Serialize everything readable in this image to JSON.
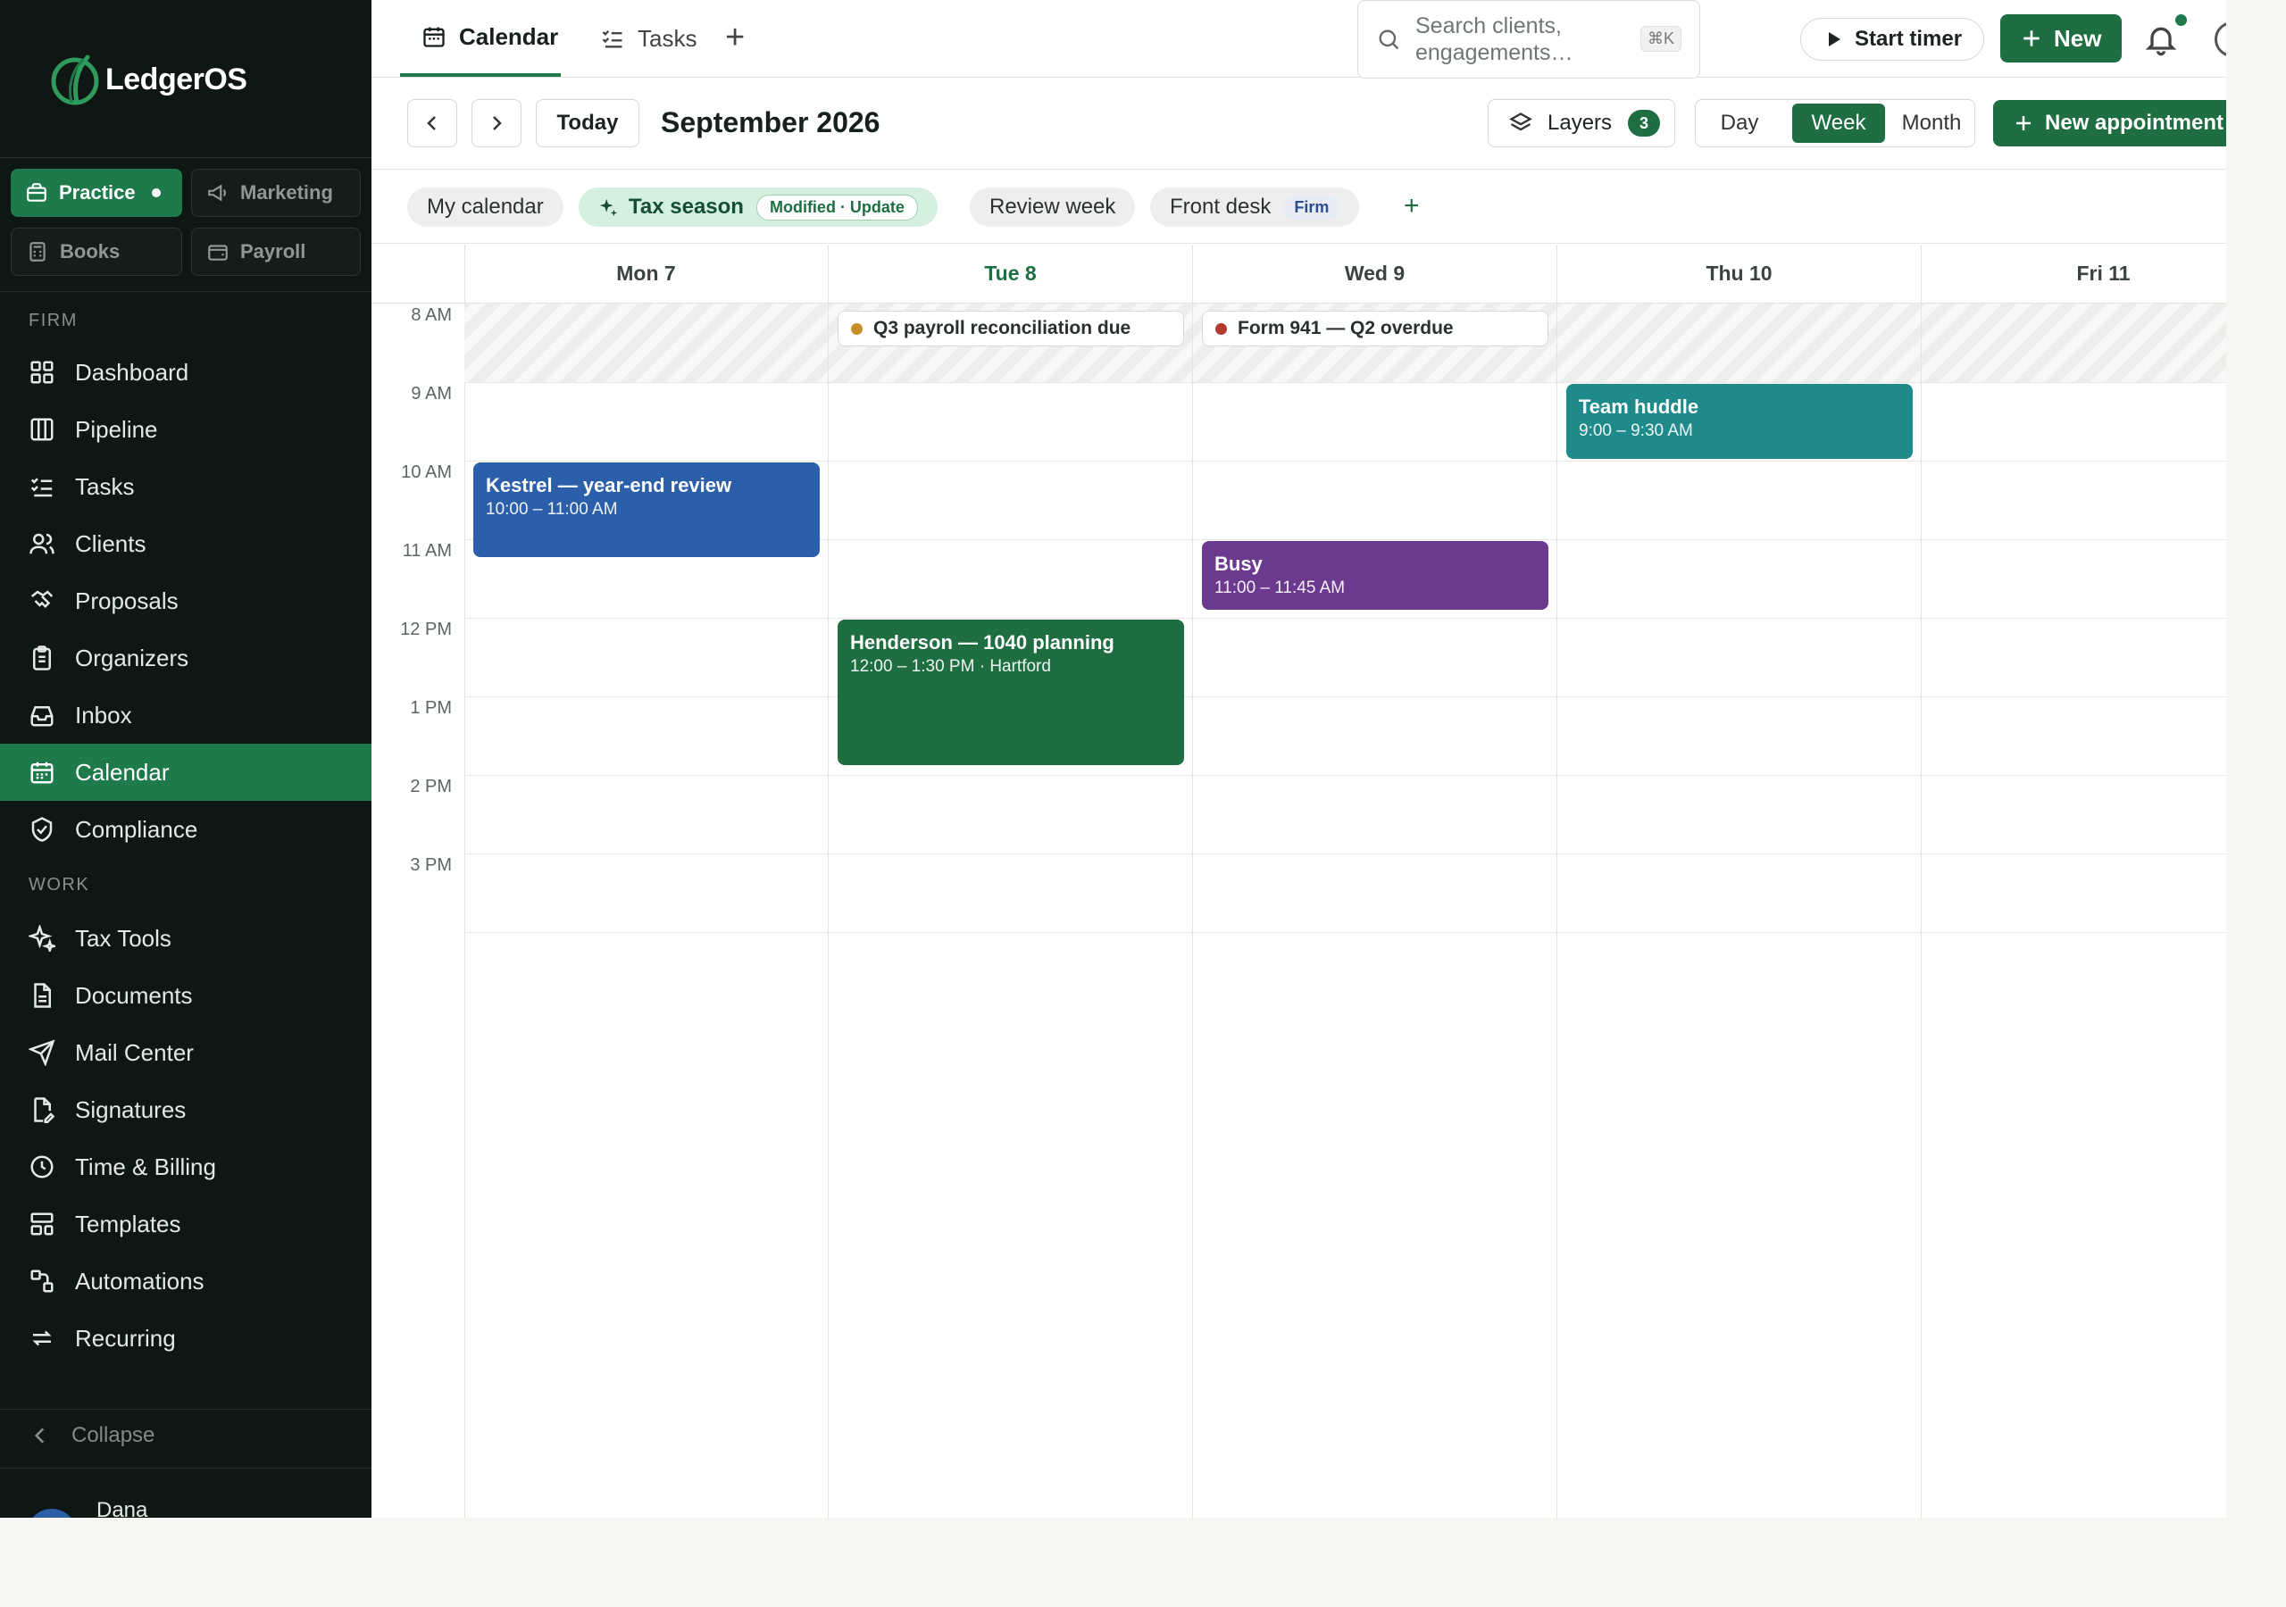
{
  "brand": {
    "name": "LedgerOS",
    "accent": "#1e7a4a"
  },
  "products": [
    {
      "label": "Practice",
      "icon": "briefcase-icon",
      "active": true
    },
    {
      "label": "Marketing",
      "icon": "megaphone-icon",
      "active": false
    },
    {
      "label": "Books",
      "icon": "calculator-icon",
      "active": false
    },
    {
      "label": "Payroll",
      "icon": "wallet-icon",
      "active": false
    }
  ],
  "sidebar": {
    "firm_label": "FIRM",
    "work_label": "WORK",
    "firm_items": [
      {
        "label": "Dashboard",
        "icon": "grid-icon"
      },
      {
        "label": "Pipeline",
        "icon": "columns-icon"
      },
      {
        "label": "Tasks",
        "icon": "checklist-icon"
      },
      {
        "label": "Clients",
        "icon": "users-icon"
      },
      {
        "label": "Proposals",
        "icon": "handshake-icon"
      },
      {
        "label": "Organizers",
        "icon": "clipboard-icon"
      },
      {
        "label": "Inbox",
        "icon": "inbox-icon"
      },
      {
        "label": "Calendar",
        "icon": "calendar-icon",
        "active": true
      },
      {
        "label": "Compliance",
        "icon": "shield-check-icon"
      }
    ],
    "work_items": [
      {
        "label": "Tax Tools",
        "icon": "sparkle-icon"
      },
      {
        "label": "Documents",
        "icon": "document-icon"
      },
      {
        "label": "Mail Center",
        "icon": "send-icon"
      },
      {
        "label": "Signatures",
        "icon": "signature-icon"
      },
      {
        "label": "Time & Billing",
        "icon": "clock-icon"
      },
      {
        "label": "Templates",
        "icon": "layout-icon"
      },
      {
        "label": "Automations",
        "icon": "workflow-icon"
      },
      {
        "label": "Recurring",
        "icon": "repeat-icon"
      }
    ],
    "collapse_label": "Collapse",
    "user_name": "Dana"
  },
  "topbar": {
    "tabs": [
      {
        "label": "Calendar",
        "icon": "calendar-icon",
        "active": true
      },
      {
        "label": "Tasks",
        "icon": "checklist-icon",
        "active": false
      }
    ],
    "search_placeholder": "Search clients, engagements…",
    "search_shortcut": "⌘K",
    "start_timer_label": "Start timer",
    "new_label": "New"
  },
  "toolbar": {
    "today_label": "Today",
    "month_title": "September 2026",
    "layers_label": "Layers",
    "layers_count": "3",
    "views": [
      {
        "label": "Day",
        "active": false
      },
      {
        "label": "Week",
        "active": true
      },
      {
        "label": "Month",
        "active": false
      }
    ],
    "new_appointment_label": "New appointment"
  },
  "chips": [
    {
      "label": "My calendar"
    },
    {
      "label": "Tax season",
      "active": true,
      "badge": "Modified · Update"
    },
    {
      "label": "Review week"
    },
    {
      "label": "Front desk",
      "tag": "Firm"
    }
  ],
  "calendar": {
    "days": [
      {
        "label": "Mon 7",
        "today": false
      },
      {
        "label": "Tue 8",
        "today": true
      },
      {
        "label": "Wed 9",
        "today": false
      },
      {
        "label": "Thu 10",
        "today": false
      },
      {
        "label": "Fri 11",
        "today": false
      }
    ],
    "hours": [
      "8 AM",
      "9 AM",
      "10 AM",
      "11 AM",
      "12 PM",
      "1 PM",
      "2 PM",
      "3 PM"
    ],
    "deadlines": [
      {
        "title": "Q3 payroll reconciliation due",
        "day": 1,
        "color": "#c8902a"
      },
      {
        "title": "Form 941 — Q2 overdue",
        "day": 2,
        "color": "#b23a2e"
      }
    ],
    "events": [
      {
        "title": "Kestrel — year-end review",
        "time": "10:00 – 11:00 AM",
        "day": 0,
        "start": 10,
        "end": 11.25,
        "color": "#2c5faa"
      },
      {
        "title": "Henderson — 1040 planning",
        "time": "12:00 – 1:30 PM · Hartford",
        "day": 1,
        "start": 12,
        "end": 13.9,
        "color": "#1e6e42"
      },
      {
        "title": "Busy",
        "time": "11:00 – 11:45 AM",
        "day": 2,
        "start": 11,
        "end": 11.92,
        "color": "#6b3a8e"
      },
      {
        "title": "Team huddle",
        "time": "9:00 – 9:30 AM",
        "day": 3,
        "start": 9,
        "end": 10,
        "color": "#1e8a8a"
      }
    ]
  }
}
